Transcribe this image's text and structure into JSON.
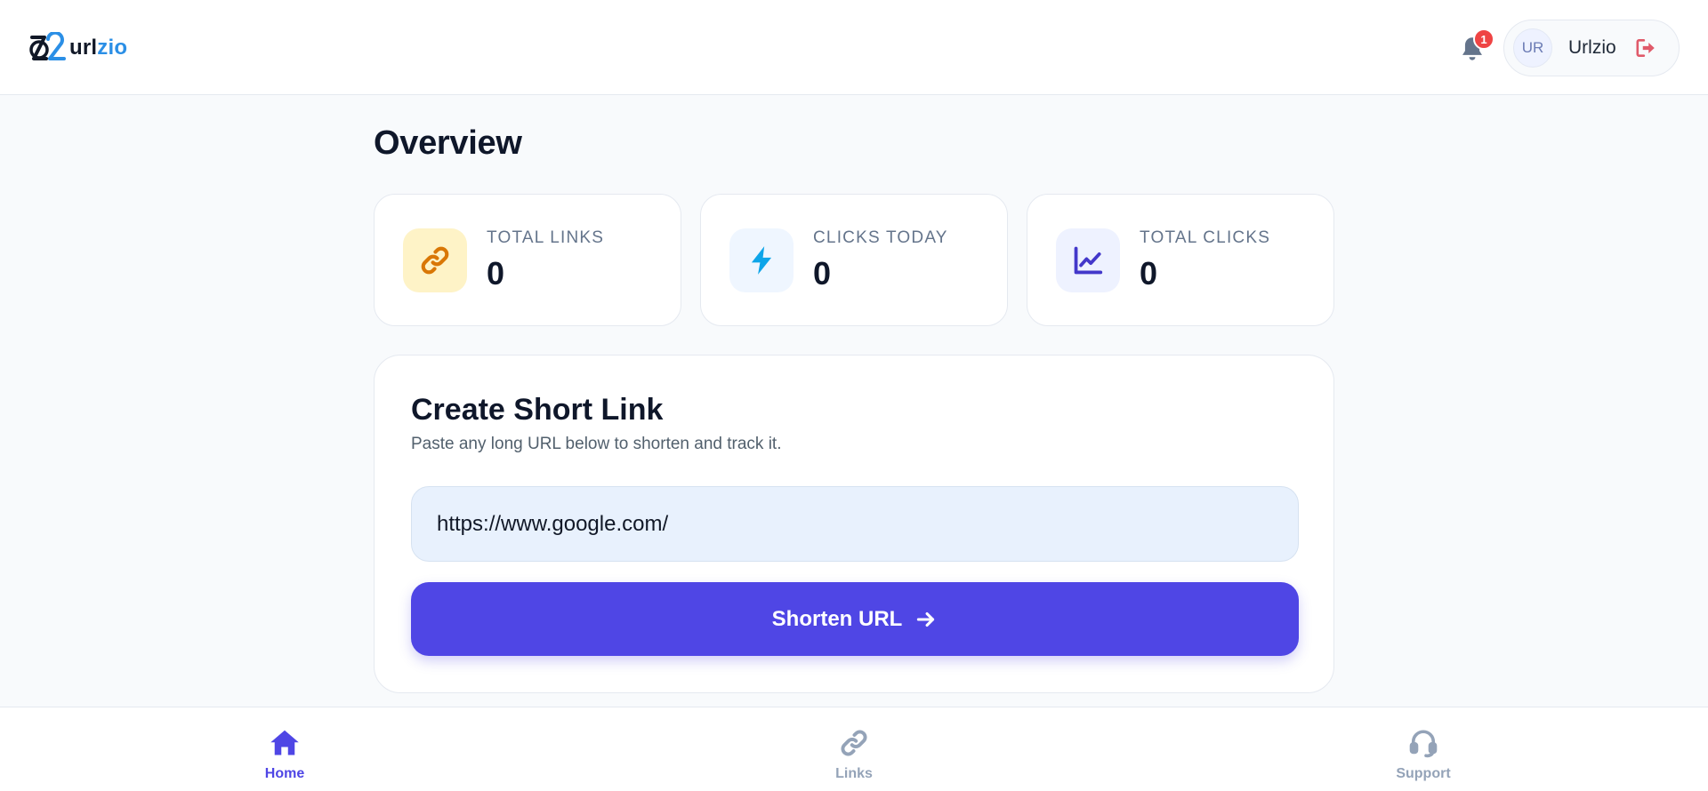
{
  "header": {
    "logo_part1": "url",
    "logo_part2": "zio",
    "notification_count": "1",
    "user_initials": "UR",
    "user_name": "Urlzio"
  },
  "main": {
    "page_title": "Overview",
    "stats": [
      {
        "label": "TOTAL LINKS",
        "value": "0",
        "icon": "link-icon",
        "icon_bg": "#fef3c7",
        "icon_color": "#d97706"
      },
      {
        "label": "CLICKS TODAY",
        "value": "0",
        "icon": "lightning-icon",
        "icon_bg": "#eff6ff",
        "icon_color": "#0ea5e9"
      },
      {
        "label": "TOTAL CLICKS",
        "value": "0",
        "icon": "chart-line-icon",
        "icon_bg": "#eef2ff",
        "icon_color": "#4338ca"
      }
    ],
    "create": {
      "title": "Create Short Link",
      "subtitle": "Paste any long URL below to shorten and track it.",
      "url_value": "https://www.google.com/",
      "button_label": "Shorten URL"
    }
  },
  "nav": {
    "items": [
      {
        "label": "Home",
        "icon": "home-icon",
        "active": true
      },
      {
        "label": "Links",
        "icon": "link-icon",
        "active": false
      },
      {
        "label": "Support",
        "icon": "headset-icon",
        "active": false
      }
    ]
  },
  "colors": {
    "primary": "#4f46e5",
    "nav_active": "#4f46e5",
    "nav_inactive": "#94a3b8",
    "badge": "#ef4444",
    "logout": "#e05a6a"
  }
}
